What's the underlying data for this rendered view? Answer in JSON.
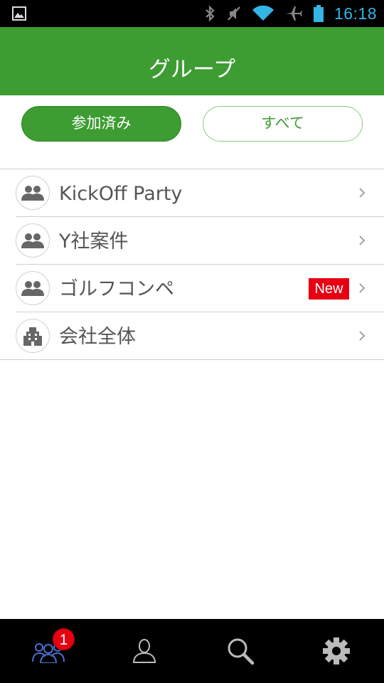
{
  "status_bar": {
    "time": "16:18",
    "icons": [
      "gallery-icon",
      "bluetooth-icon",
      "mute-icon",
      "wifi-icon",
      "airplane-mode-icon",
      "battery-icon"
    ],
    "time_color": "#33b5e5"
  },
  "header": {
    "title": "グループ",
    "background": "#3d9c32"
  },
  "filter": {
    "joined_label": "参加済み",
    "all_label": "すべて",
    "selected": "joined"
  },
  "groups": [
    {
      "name": "KickOff Party",
      "icon": "people-icon",
      "new": false
    },
    {
      "name": "Y社案件",
      "icon": "people-icon",
      "new": false
    },
    {
      "name": "ゴルフコンペ",
      "icon": "people-icon",
      "new": true
    },
    {
      "name": "会社全体",
      "icon": "building-icon",
      "new": false
    }
  ],
  "badges": {
    "new_label": "New"
  },
  "bottom_nav": {
    "tabs": [
      "groups-icon",
      "profile-icon",
      "search-icon",
      "settings-icon"
    ],
    "selected": "groups",
    "notification_count": "1"
  }
}
